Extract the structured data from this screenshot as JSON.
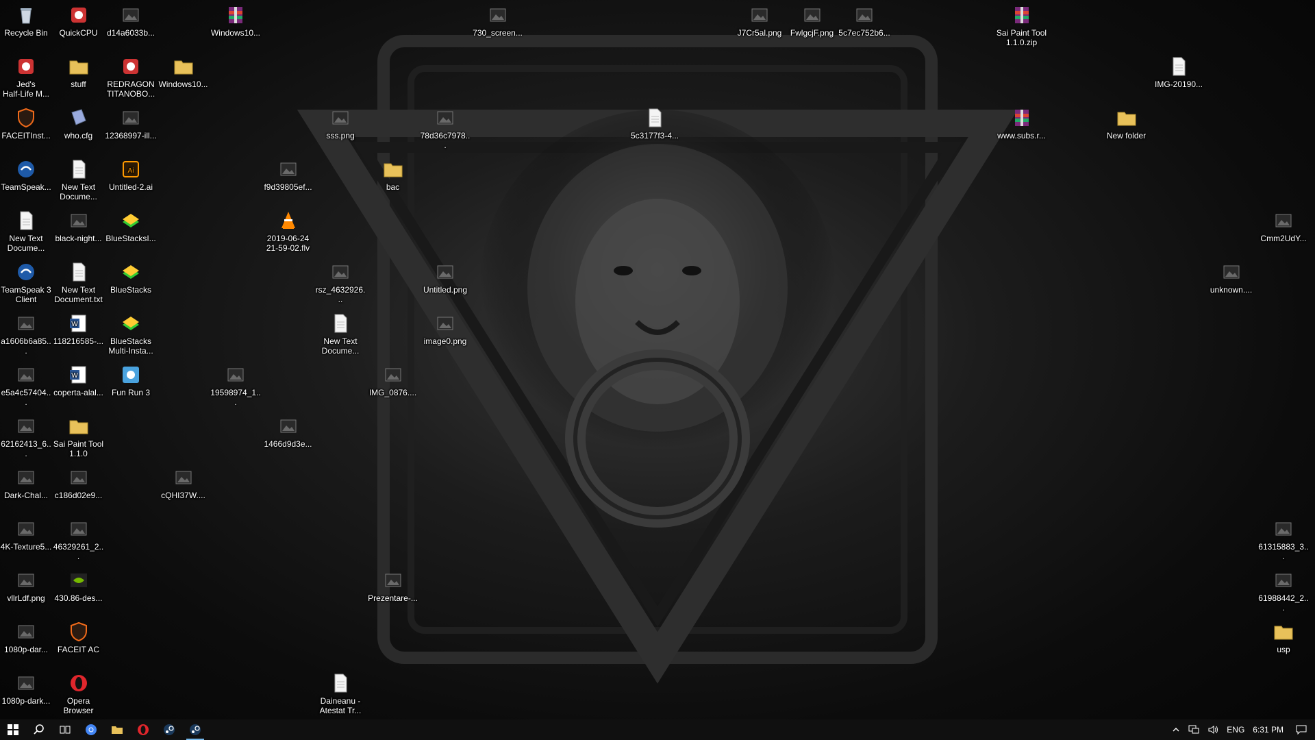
{
  "desktop": {
    "icons": [
      {
        "label": "Recycle Bin",
        "icon": "recycle-bin-icon",
        "col": 0,
        "row": 0
      },
      {
        "label": "QuickCPU",
        "icon": "app-icon",
        "col": 1,
        "row": 0
      },
      {
        "label": "d14a6033b...",
        "icon": "image-file-icon",
        "col": 2,
        "row": 0
      },
      {
        "label": "Windows10...",
        "icon": "archive-icon",
        "col": 4,
        "row": 0
      },
      {
        "label": "730_screen...",
        "icon": "image-file-icon",
        "col": 9,
        "row": 0
      },
      {
        "label": "J7Cr5al.png",
        "icon": "image-file-icon",
        "col": 14,
        "row": 0
      },
      {
        "label": "FwlgcjF.png",
        "icon": "image-file-icon",
        "col": 15,
        "row": 0
      },
      {
        "label": "5c7ec752b6...",
        "icon": "image-file-icon",
        "col": 16,
        "row": 0
      },
      {
        "label": "Sai Paint Tool\n1.1.0.zip",
        "icon": "archive-icon",
        "col": 19,
        "row": 0
      },
      {
        "label": "Jed's\nHalf-Life M...",
        "icon": "app-icon",
        "col": 0,
        "row": 1
      },
      {
        "label": "stuff",
        "icon": "folder-icon",
        "col": 1,
        "row": 1
      },
      {
        "label": "REDRAGON\nTITANOBO...",
        "icon": "app-icon",
        "col": 2,
        "row": 1
      },
      {
        "label": "Windows10...",
        "icon": "folder-icon",
        "col": 3,
        "row": 1
      },
      {
        "label": "IMG-20190...",
        "icon": "document-icon",
        "col": 22,
        "row": 1
      },
      {
        "label": "FACEITInst...",
        "icon": "shield-icon",
        "col": 0,
        "row": 2
      },
      {
        "label": "who.cfg",
        "icon": "config-file-icon",
        "col": 1,
        "row": 2
      },
      {
        "label": "12368997-ill...",
        "icon": "image-file-icon",
        "col": 2,
        "row": 2
      },
      {
        "label": "sss.png",
        "icon": "image-file-icon",
        "col": 6,
        "row": 2
      },
      {
        "label": "78d36c7978...",
        "icon": "image-file-icon",
        "col": 8,
        "row": 2
      },
      {
        "label": "5c3177f3-4...",
        "icon": "document-icon",
        "col": 12,
        "row": 2
      },
      {
        "label": "www.subs.r...",
        "icon": "archive-icon",
        "col": 19,
        "row": 2
      },
      {
        "label": "New folder",
        "icon": "folder-icon",
        "col": 21,
        "row": 2
      },
      {
        "label": "TeamSpeak...",
        "icon": "teamspeak-icon",
        "col": 0,
        "row": 3
      },
      {
        "label": "New Text\nDocume...",
        "icon": "document-icon",
        "col": 1,
        "row": 3
      },
      {
        "label": "Untitled-2.ai",
        "icon": "illustrator-icon",
        "col": 2,
        "row": 3
      },
      {
        "label": "f9d39805ef...",
        "icon": "image-file-icon",
        "col": 5,
        "row": 3
      },
      {
        "label": "bac",
        "icon": "folder-icon",
        "col": 7,
        "row": 3
      },
      {
        "label": "New Text\nDocume...",
        "icon": "document-icon",
        "col": 0,
        "row": 4
      },
      {
        "label": "black-night...",
        "icon": "image-file-icon",
        "col": 1,
        "row": 4
      },
      {
        "label": "BlueStacksI...",
        "icon": "bluestacks-icon",
        "col": 2,
        "row": 4
      },
      {
        "label": "2019-06-24\n21-59-02.flv",
        "icon": "vlc-icon",
        "col": 5,
        "row": 4
      },
      {
        "label": "Cmm2UdY...",
        "icon": "image-file-icon",
        "col": 24,
        "row": 4
      },
      {
        "label": "TeamSpeak 3\nClient",
        "icon": "teamspeak-icon",
        "col": 0,
        "row": 5
      },
      {
        "label": "New Text\nDocument.txt",
        "icon": "document-icon",
        "col": 1,
        "row": 5
      },
      {
        "label": "BlueStacks",
        "icon": "bluestacks-icon",
        "col": 2,
        "row": 5
      },
      {
        "label": "rsz_4632926...",
        "icon": "image-file-icon",
        "col": 6,
        "row": 5
      },
      {
        "label": "Untitled.png",
        "icon": "image-file-icon",
        "col": 8,
        "row": 5
      },
      {
        "label": "unknown....",
        "icon": "image-file-icon",
        "col": 23,
        "row": 5
      },
      {
        "label": "a1606b6a85...",
        "icon": "image-file-icon",
        "col": 0,
        "row": 6
      },
      {
        "label": "118216585-...",
        "icon": "word-icon",
        "col": 1,
        "row": 6
      },
      {
        "label": "BlueStacks\nMulti-Insta...",
        "icon": "bluestacks-icon",
        "col": 2,
        "row": 6
      },
      {
        "label": "New Text\nDocume...",
        "icon": "document-icon",
        "col": 6,
        "row": 6
      },
      {
        "label": "image0.png",
        "icon": "image-file-icon",
        "col": 8,
        "row": 6
      },
      {
        "label": "e5a4c57404...",
        "icon": "image-file-icon",
        "col": 0,
        "row": 7
      },
      {
        "label": "coperta-alal...",
        "icon": "word-icon",
        "col": 1,
        "row": 7
      },
      {
        "label": "Fun Run 3",
        "icon": "game-icon",
        "col": 2,
        "row": 7
      },
      {
        "label": "19598974_1...",
        "icon": "image-file-icon",
        "col": 4,
        "row": 7
      },
      {
        "label": "IMG_0876....",
        "icon": "image-file-icon",
        "col": 7,
        "row": 7
      },
      {
        "label": "62162413_6...",
        "icon": "image-file-icon",
        "col": 0,
        "row": 8
      },
      {
        "label": "Sai Paint Tool\n1.1.0",
        "icon": "folder-icon",
        "col": 1,
        "row": 8
      },
      {
        "label": "1466d9d3e...",
        "icon": "image-file-icon",
        "col": 5,
        "row": 8
      },
      {
        "label": "Dark-Chal...",
        "icon": "image-file-icon",
        "col": 0,
        "row": 9
      },
      {
        "label": "c186d02e9...",
        "icon": "image-file-icon",
        "col": 1,
        "row": 9
      },
      {
        "label": "cQHI37W....",
        "icon": "image-file-icon",
        "col": 3,
        "row": 9
      },
      {
        "label": "4K-Texture5...",
        "icon": "image-file-icon",
        "col": 0,
        "row": 10
      },
      {
        "label": "46329261_2...",
        "icon": "image-file-icon",
        "col": 1,
        "row": 10
      },
      {
        "label": "61315883_3...",
        "icon": "image-file-icon",
        "col": 24,
        "row": 10
      },
      {
        "label": "vllrLdf.png",
        "icon": "image-file-icon",
        "col": 0,
        "row": 11
      },
      {
        "label": "430.86-des...",
        "icon": "nvidia-icon",
        "col": 1,
        "row": 11
      },
      {
        "label": "Prezentare-...",
        "icon": "image-file-icon",
        "col": 7,
        "row": 11
      },
      {
        "label": "61988442_2...",
        "icon": "image-file-icon",
        "col": 24,
        "row": 11
      },
      {
        "label": "1080p-dar...",
        "icon": "image-file-icon",
        "col": 0,
        "row": 12
      },
      {
        "label": "FACEIT AC",
        "icon": "shield-icon",
        "col": 1,
        "row": 12
      },
      {
        "label": "usp",
        "icon": "folder-icon",
        "col": 24,
        "row": 12
      },
      {
        "label": "1080p-dark...",
        "icon": "image-file-icon",
        "col": 0,
        "row": 13
      },
      {
        "label": "Opera\nBrowser",
        "icon": "opera-icon",
        "col": 1,
        "row": 13
      },
      {
        "label": "Daineanu -\nAtestat Tr...",
        "icon": "document-icon",
        "col": 6,
        "row": 13
      }
    ]
  },
  "taskbar": {
    "buttons": [
      {
        "name": "start-button",
        "icon": "windows-logo-icon",
        "active": false
      },
      {
        "name": "search-button",
        "icon": "search-icon",
        "active": false
      },
      {
        "name": "task-view-button",
        "icon": "task-view-icon",
        "active": false
      },
      {
        "name": "taskbar-chrome-button",
        "icon": "chrome-icon",
        "active": false
      },
      {
        "name": "taskbar-file-explorer-button",
        "icon": "folder-icon",
        "active": false
      },
      {
        "name": "taskbar-opera-button",
        "icon": "opera-icon",
        "active": false
      },
      {
        "name": "taskbar-steam-button",
        "icon": "steam-icon",
        "active": false
      },
      {
        "name": "taskbar-steam-active-button",
        "icon": "steam-icon",
        "active": true
      }
    ],
    "tray": {
      "language": "ENG",
      "time": "6:31 PM"
    }
  },
  "colors": {
    "folder": "#e8c15a",
    "taskbar": "#101010",
    "accent": "#76b9ed"
  }
}
